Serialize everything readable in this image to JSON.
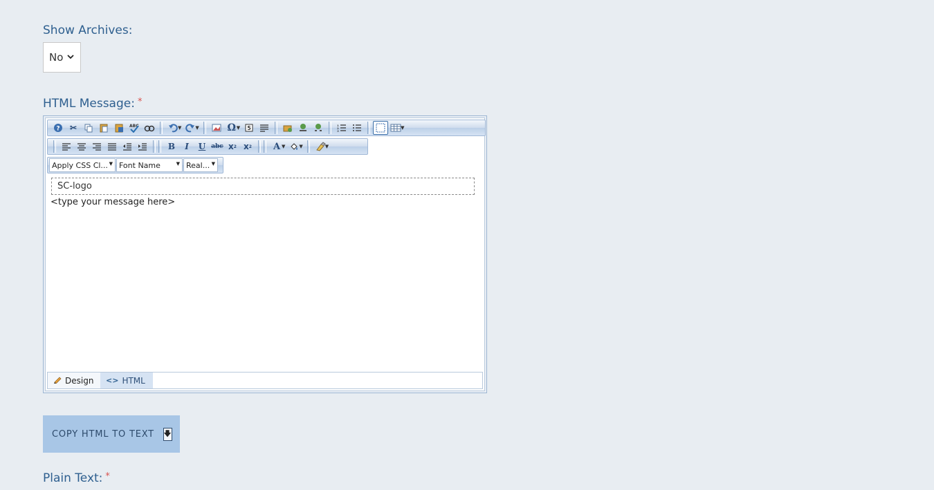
{
  "archives": {
    "label": "Show Archives:",
    "selected": "No"
  },
  "html_message": {
    "label": "HTML Message:",
    "required_mark": "*"
  },
  "editor": {
    "toolbar1_icons": [
      "help-icon",
      "cut-icon",
      "copy-icon",
      "paste-icon",
      "paste-word-icon",
      "spellcheck-icon",
      "find-replace-icon",
      "undo-icon",
      "redo-icon",
      "image-icon",
      "symbol-icon",
      "template-icon",
      "paragraph-icon",
      "link-manager-icon",
      "hyperlink-icon",
      "unlink-icon",
      "ordered-list-icon",
      "bulleted-list-icon",
      "toggle-borders-icon",
      "table-icon"
    ],
    "toolbar2_icons": [
      "align-left-icon",
      "align-center-icon",
      "align-right-icon",
      "justify-icon",
      "outdent-icon",
      "indent-icon",
      "bold-icon",
      "italic-icon",
      "underline-icon",
      "strikethrough-icon",
      "subscript-icon",
      "superscript-icon",
      "font-color-icon",
      "highlight-icon",
      "format-stripper-icon"
    ],
    "combo_css": "Apply CSS Cl...",
    "combo_font": "Font Name",
    "combo_size": "Real...",
    "logo_alt": "SC-logo",
    "message_placeholder": "<type your message here>",
    "tab_design": "Design",
    "tab_html": "HTML"
  },
  "copy_button": {
    "label": "COPY HTML TO TEXT"
  },
  "plain_text": {
    "label": "Plain Text:",
    "required_mark": "*"
  },
  "colors": {
    "label": "#2e5f8f",
    "required": "#d9534f",
    "button_bg": "#a8c6e6",
    "page_bg": "#e8edf2"
  }
}
